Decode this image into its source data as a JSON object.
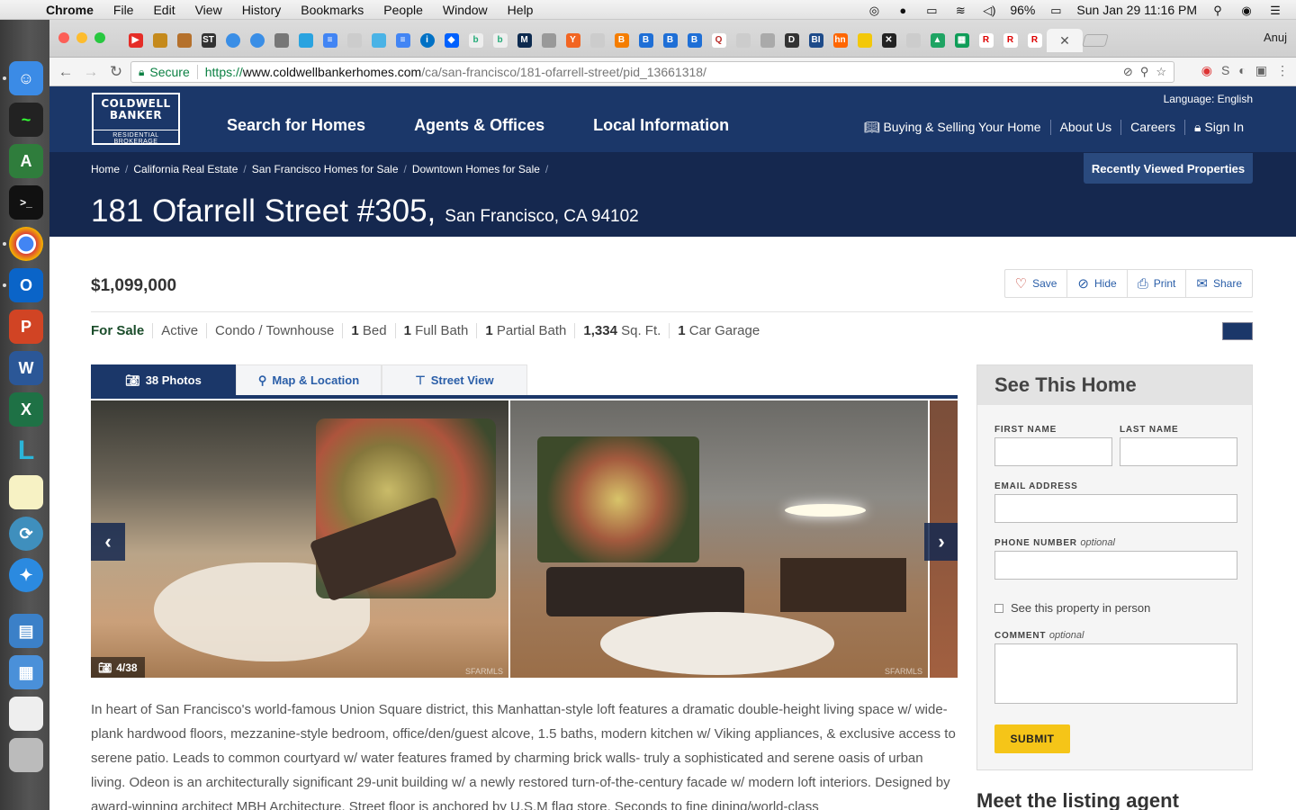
{
  "menubar": {
    "app": "Chrome",
    "items": [
      "File",
      "Edit",
      "View",
      "History",
      "Bookmarks",
      "People",
      "Window",
      "Help"
    ],
    "battery": "96%",
    "datetime": "Sun Jan 29  11:16 PM"
  },
  "browser": {
    "profile": "Anuj",
    "secure_label": "Secure",
    "url_scheme": "https://",
    "url_host": "www.coldwellbankerhomes.com",
    "url_path": "/ca/san-francisco/181-ofarrell-street/pid_13661318/"
  },
  "site": {
    "logo_line1": "COLDWELL",
    "logo_line2": "BANKER",
    "logo_sub": "RESIDENTIAL BROKERAGE",
    "nav": [
      "Search for Homes",
      "Agents & Offices",
      "Local Information"
    ],
    "language": "Language: English",
    "subnav": [
      "Buying & Selling Your Home",
      "About Us",
      "Careers",
      "Sign In"
    ],
    "breadcrumbs": [
      "Home",
      "California Real Estate",
      "San Francisco Homes for Sale",
      "Downtown Homes for Sale"
    ],
    "recently_viewed": "Recently Viewed Properties",
    "street": "181 Ofarrell Street #305,",
    "city": "San Francisco, CA 94102"
  },
  "listing": {
    "price": "$1,099,000",
    "actions": [
      "Save",
      "Hide",
      "Print",
      "Share"
    ],
    "status": "For Sale",
    "state": "Active",
    "type": "Condo / Townhouse",
    "beds_num": "1",
    "beds_label": "Bed",
    "fullbath_num": "1",
    "fullbath_label": "Full Bath",
    "partbath_num": "1",
    "partbath_label": "Partial Bath",
    "sqft_num": "1,334",
    "sqft_label": "Sq. Ft.",
    "garage_num": "1",
    "garage_label": "Car Garage",
    "media_tabs": [
      "38 Photos",
      "Map & Location",
      "Street View"
    ],
    "photo_counter": "4/38",
    "watermark": "SFARMLS",
    "description": "In heart of San Francisco's world-famous Union Square district, this Manhattan-style loft features a dramatic double-height living space w/ wide-plank hardwood floors, mezzanine-style bedroom, office/den/guest alcove, 1.5 baths, modern kitchen w/ Viking appliances, & exclusive access to serene patio. Leads to common courtyard w/ water features framed by charming brick walls- truly a sophisticated and serene oasis of urban living. Odeon is an architecturally significant 29-unit building w/ a newly restored turn-of-the-century facade w/ modern loft interiors. Designed by award-winning architect MBH Architecture. Street floor is anchored by U.S.M flag store. Seconds to fine dining/world-class"
  },
  "form": {
    "title": "See This Home",
    "first_name": "FIRST NAME",
    "last_name": "LAST NAME",
    "email": "EMAIL ADDRESS",
    "phone": "PHONE NUMBER",
    "phone_opt": "optional",
    "in_person": "See this property in person",
    "comment": "COMMENT",
    "comment_opt": "optional",
    "submit": "SUBMIT",
    "next_heading": "Meet the listing agent"
  }
}
